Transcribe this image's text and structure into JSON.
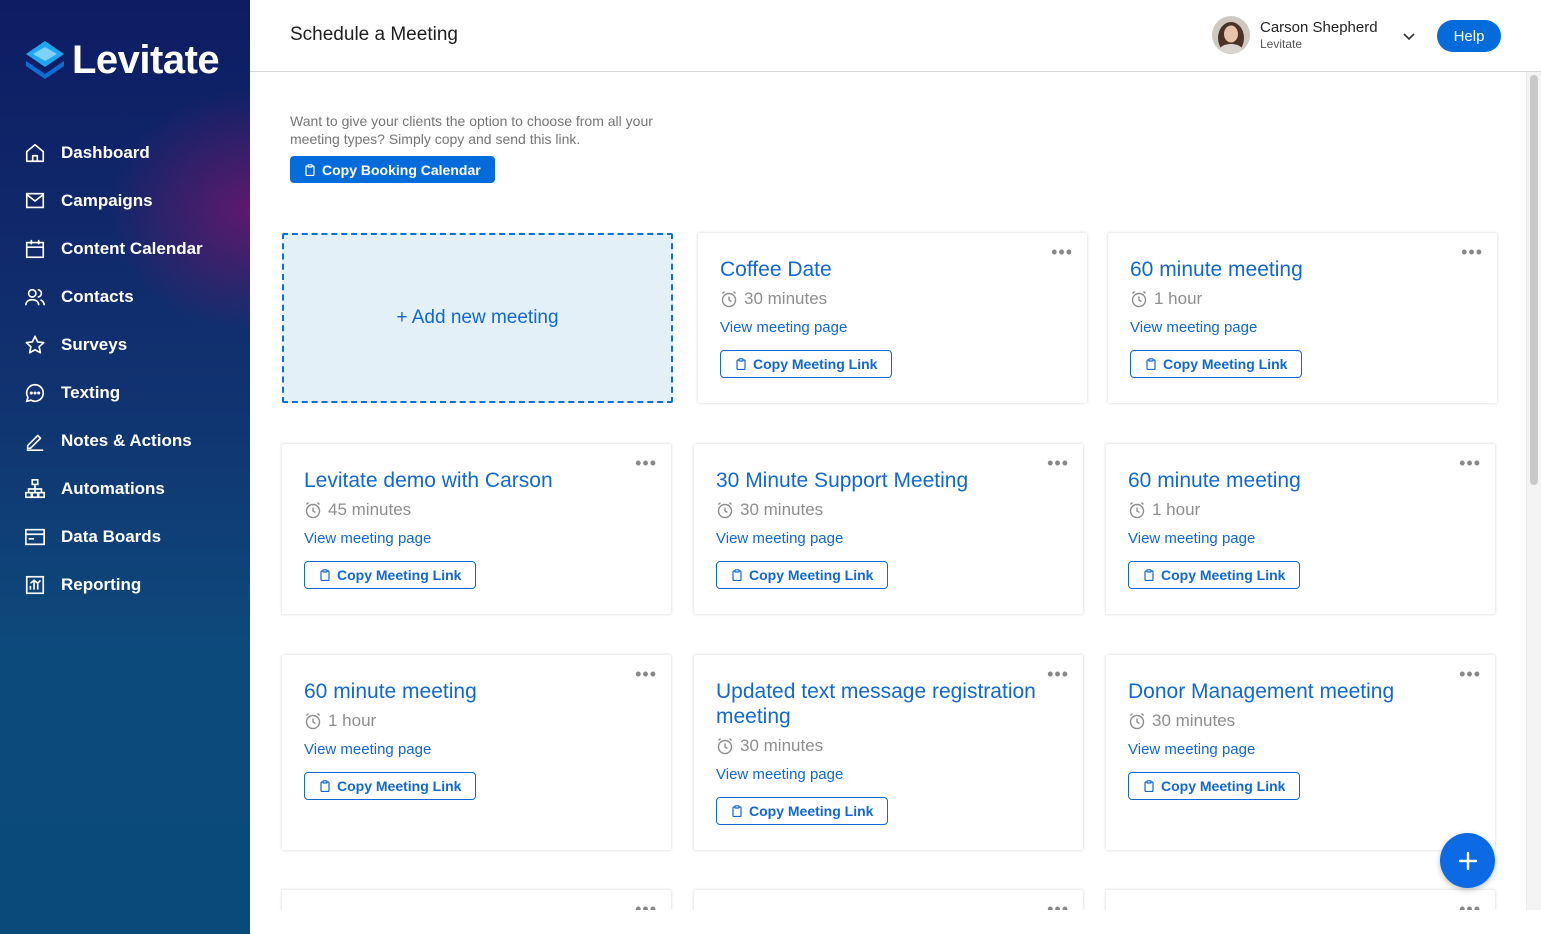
{
  "brand": {
    "name": "Levitate",
    "accent": "#046cda"
  },
  "sidebar": {
    "items": [
      {
        "label": "Dashboard",
        "icon": "home-icon"
      },
      {
        "label": "Campaigns",
        "icon": "mail-icon"
      },
      {
        "label": "Content Calendar",
        "icon": "calendar-icon"
      },
      {
        "label": "Contacts",
        "icon": "users-icon"
      },
      {
        "label": "Surveys",
        "icon": "star-icon"
      },
      {
        "label": "Texting",
        "icon": "chat-icon"
      },
      {
        "label": "Notes & Actions",
        "icon": "pencil-icon"
      },
      {
        "label": "Automations",
        "icon": "hierarchy-icon"
      },
      {
        "label": "Data Boards",
        "icon": "card-icon"
      },
      {
        "label": "Reporting",
        "icon": "chart-icon"
      }
    ]
  },
  "header": {
    "title": "Schedule a Meeting",
    "user_name": "Carson Shepherd",
    "user_org": "Levitate",
    "help_label": "Help"
  },
  "main": {
    "intro": "Want to give your clients the option to choose from all your meeting types? Simply copy and send this link.",
    "copy_calendar_label": "Copy Booking Calendar",
    "add_new_label": "+ Add new meeting",
    "view_label": "View meeting page",
    "copy_link_label": "Copy Meeting Link",
    "more_label": "•••",
    "meetings": [
      {
        "title": "Coffee Date",
        "duration": "30 minutes"
      },
      {
        "title": "60 minute meeting",
        "duration": "1 hour"
      },
      {
        "title": "Levitate demo with Carson",
        "duration": "45 minutes"
      },
      {
        "title": "30 Minute Support Meeting",
        "duration": "30 minutes"
      },
      {
        "title": "60 minute meeting",
        "duration": "1 hour"
      },
      {
        "title": "60 minute meeting",
        "duration": "1 hour"
      },
      {
        "title": "Updated text message registration meeting",
        "duration": "30 minutes"
      },
      {
        "title": "Donor Management meeting",
        "duration": "30 minutes"
      }
    ]
  }
}
